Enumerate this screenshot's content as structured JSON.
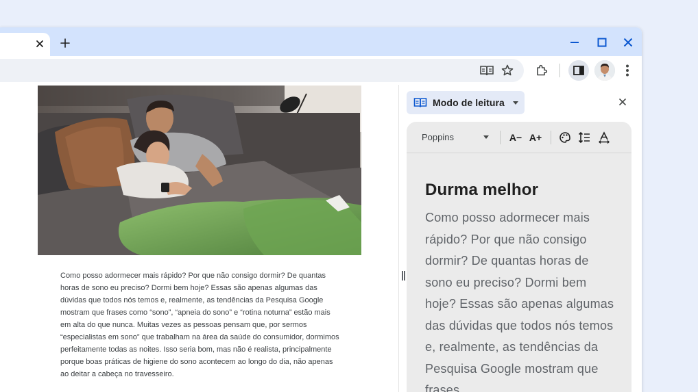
{
  "browser": {
    "new_tab_label": "+",
    "toolbar_icons": [
      "reading-mode-icon",
      "bookmark-star-icon",
      "extensions-icon",
      "side-panel-icon",
      "avatar",
      "more-vert-icon"
    ],
    "window_controls": [
      "minimize-icon",
      "maximize-icon",
      "close-icon"
    ]
  },
  "article": {
    "paragraph": "Como posso adormecer mais rápido? Por que não consigo dormir? De quantas horas de sono eu preciso? Dormi bem hoje? Essas são apenas algumas das dúvidas que todos nós temos e, realmente, as tendências da Pesquisa Google mostram que frases como “sono”, “apneia do sono” e “rotina noturna” estão mais em alta do que nunca. Muitas vezes as pessoas pensam que, por sermos “especialistas em sono” que trabalham na área da saúde do consumidor, dormimos perfeitamente todas as noites. Isso seria bom, mas não é realista, principalmente porque boas práticas de higiene do sono acontecem ao longo do dia, não apenas ao deitar a cabeça no travesseiro."
  },
  "side_panel": {
    "mode_label": "Modo de leitura",
    "font_name": "Poppins",
    "decrease_font_label": "A−",
    "increase_font_label": "A+",
    "reader_title": "Durma melhor",
    "reader_body": "Como posso adormecer mais rápido? Por que não consigo dormir? De quantas horas de sono eu preciso? Dormi bem hoje? Essas são apenas algumas das dúvidas que todos nós temos e, realmente, as tendências da Pesquisa Google mostram que frases"
  },
  "colors": {
    "background": "#e9effb",
    "titlebar": "#d3e3fd",
    "reader_bg": "#ebebeb",
    "accent": "#0b57d0"
  }
}
